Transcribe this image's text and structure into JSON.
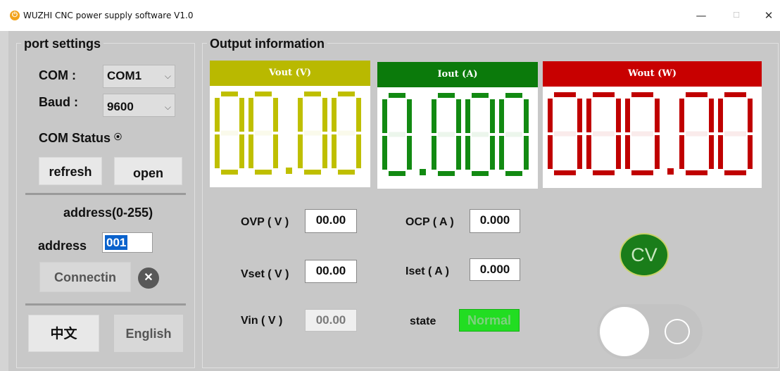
{
  "window": {
    "title": "WUZHI CNC power supply software V1.0",
    "min_glyph": "—",
    "max_glyph": "☐",
    "close_glyph": "✕"
  },
  "port_settings": {
    "title": "port settings",
    "com_label": "COM :",
    "com_value": "COM1",
    "baud_label": "Baud :",
    "baud_value": "9600",
    "status_label": "COM Status",
    "status_indicator": "⦿",
    "refresh_label": "refresh",
    "open_label": "open",
    "address_range_label": "address(0-255)",
    "address_label": "address",
    "address_value": "001",
    "connect_label": "Connectin",
    "close_glyph": "✕",
    "chinese_label": "中文",
    "english_label": "English"
  },
  "output": {
    "title": "Output information",
    "meters": [
      {
        "header": "Vout (V)",
        "digits": [
          "0",
          "0"
        ],
        "decimals": [
          "0",
          "0"
        ],
        "color": "#bfbf00",
        "header_color": "#b9b900"
      },
      {
        "header": "Iout (A)",
        "digits": [
          "0"
        ],
        "decimals": [
          "0",
          "0",
          "0"
        ],
        "color": "#128a12",
        "header_color": "#0b7a0b"
      },
      {
        "header": "Wout (W)",
        "digits": [
          "0",
          "0",
          "0"
        ],
        "decimals": [
          "0",
          "0"
        ],
        "color": "#c00000",
        "header_color": "#c80000"
      }
    ],
    "ovp_label": "OVP ( V )",
    "ovp_value": "00.00",
    "ocp_label": "OCP ( A )",
    "ocp_value": "0.000",
    "vset_label": "Vset ( V )",
    "vset_value": "00.00",
    "iset_label": "Iset ( A )",
    "iset_value": "0.000",
    "vin_label": "Vin ( V )",
    "vin_value": "00.00",
    "state_label": "state",
    "state_value": "Normal",
    "state_color": "#22dd22",
    "mode": "CV"
  }
}
